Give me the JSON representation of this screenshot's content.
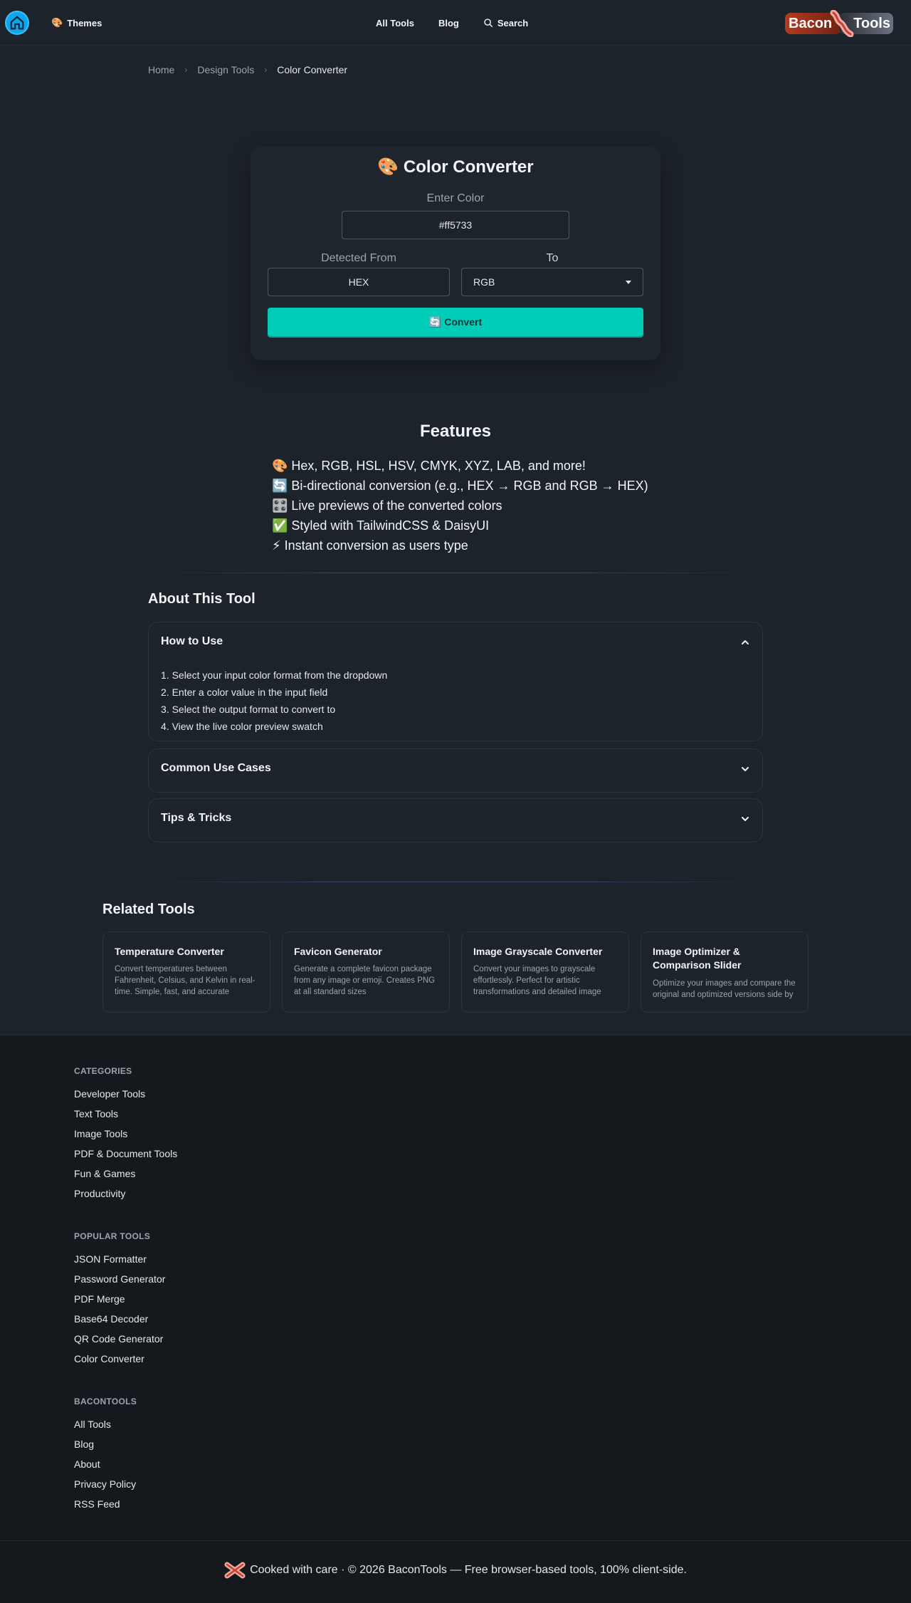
{
  "header": {
    "themes_icon": "🎨",
    "themes_label": "Themes",
    "nav": [
      "All Tools",
      "Blog"
    ],
    "search_label": "Search",
    "logo_left": "Bacon",
    "logo_right": "Tools"
  },
  "breadcrumb": [
    "Home",
    "Design Tools",
    "Color Converter"
  ],
  "converter": {
    "title": "🎨 Color Converter",
    "enter_label": "Enter Color",
    "color_value": "#ff5733",
    "detected_label": "Detected From",
    "detected_value": "HEX",
    "to_label": "To",
    "to_value": "RGB",
    "convert_label": "🔄 Convert",
    "convert_color": "#00cdb8"
  },
  "features": {
    "title": "Features",
    "items": [
      "🎨 Hex, RGB, HSL, HSV, CMYK, XYZ, LAB, and more!",
      "🔄 Bi-directional conversion (e.g., HEX → RGB and RGB → HEX)",
      "🎛️ Live previews of the converted colors",
      "✅ Styled with TailwindCSS & DaisyUI",
      "⚡ Instant conversion as users type"
    ]
  },
  "about": {
    "title": "About This Tool",
    "sections": [
      {
        "title": "How to Use",
        "expanded": true,
        "items": [
          "1. Select your input color format from the dropdown",
          "2. Enter a color value in the input field",
          "3. Select the output format to convert to",
          "4. View the live color preview swatch"
        ]
      },
      {
        "title": "Common Use Cases",
        "expanded": false
      },
      {
        "title": "Tips & Tricks",
        "expanded": false
      }
    ]
  },
  "related": {
    "title": "Related Tools",
    "tools": [
      {
        "title": "Temperature Converter",
        "desc": "Convert temperatures between Fahrenheit, Celsius, and Kelvin in real-time. Simple, fast, and accurate"
      },
      {
        "title": "Favicon Generator",
        "desc": "Generate a complete favicon package from any image or emoji. Creates PNG at all standard sizes"
      },
      {
        "title": "Image Grayscale Converter",
        "desc": "Convert your images to grayscale effortlessly. Perfect for artistic transformations and detailed image"
      },
      {
        "title": "Image Optimizer & Comparison Slider",
        "desc": "Optimize your images and compare the original and optimized versions side by side"
      }
    ]
  },
  "footer": {
    "categories_heading": "CATEGORIES",
    "categories": [
      "Developer Tools",
      "Text Tools",
      "Image Tools",
      "PDF & Document Tools",
      "Fun & Games",
      "Productivity"
    ],
    "popular_heading": "POPULAR TOOLS",
    "popular": [
      "JSON Formatter",
      "Password Generator",
      "PDF Merge",
      "Base64 Decoder",
      "QR Code Generator",
      "Color Converter"
    ],
    "brand_heading": "BACONTOOLS",
    "brand_links": [
      "All Tools",
      "Blog",
      "About",
      "Privacy Policy",
      "RSS Feed"
    ],
    "copyright": "Cooked with care · © 2026 BaconTools — Free browser-based tools, 100% client-side."
  }
}
